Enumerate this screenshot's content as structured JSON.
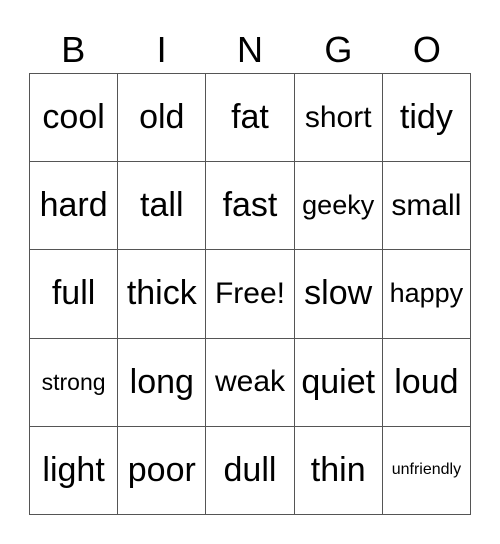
{
  "header": [
    "B",
    "I",
    "N",
    "G",
    "O"
  ],
  "cells": [
    [
      "cool",
      "old",
      "fat",
      "short",
      "tidy"
    ],
    [
      "hard",
      "tall",
      "fast",
      "geeky",
      "small"
    ],
    [
      "full",
      "thick",
      "Free!",
      "slow",
      "happy"
    ],
    [
      "strong",
      "long",
      "weak",
      "quiet",
      "loud"
    ],
    [
      "light",
      "poor",
      "dull",
      "thin",
      "unfriendly"
    ]
  ]
}
